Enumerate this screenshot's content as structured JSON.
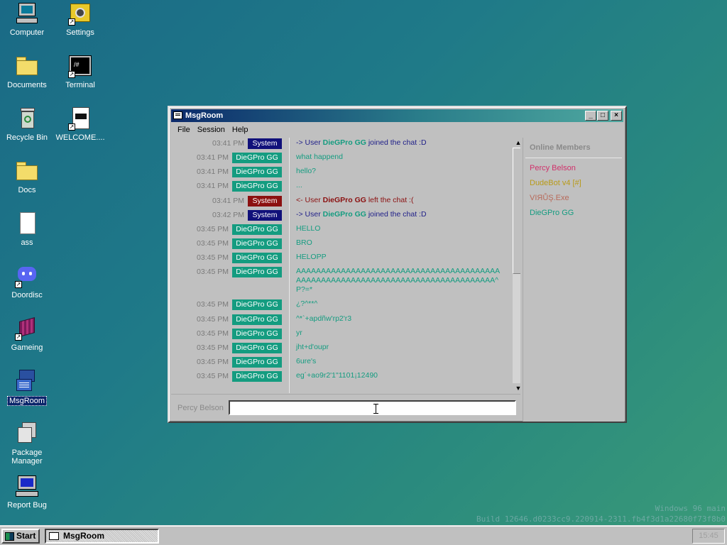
{
  "desktop": {
    "icons": [
      {
        "label": "Computer",
        "icon": "computer-icon"
      },
      {
        "label": "Settings",
        "icon": "settings-icon"
      },
      {
        "label": "Documents",
        "icon": "folder-icon"
      },
      {
        "label": "Terminal",
        "icon": "terminal-icon"
      },
      {
        "label": "Recycle Bin",
        "icon": "recycle-bin-icon"
      },
      {
        "label": "WELCOME....",
        "icon": "document-icon"
      },
      {
        "label": "Docs",
        "icon": "folder-icon"
      },
      {
        "label": "ass",
        "icon": "file-icon"
      },
      {
        "label": "Doordisc",
        "icon": "discord-icon"
      },
      {
        "label": "Gameing",
        "icon": "cube-icon"
      },
      {
        "label": "MsgRoom",
        "icon": "msgroom-icon"
      },
      {
        "label": "Package Manager",
        "icon": "package-icon"
      },
      {
        "label": "Report Bug",
        "icon": "report-bug-icon"
      }
    ]
  },
  "window": {
    "title": "MsgRoom",
    "menu": [
      "File",
      "Session",
      "Help"
    ],
    "messages": [
      {
        "time": "03:41 PM",
        "user": "System",
        "pre": "-> User ",
        "nick": "DieGPro GG",
        "post": " joined the chat :D",
        "kind": "sys-in"
      },
      {
        "time": "03:41 PM",
        "user": "DieGPro GG",
        "text": "what happend",
        "kind": "user"
      },
      {
        "time": "03:41 PM",
        "user": "DieGPro GG",
        "text": "hello?",
        "kind": "user"
      },
      {
        "time": "03:41 PM",
        "user": "DieGPro GG",
        "text": "...",
        "kind": "user"
      },
      {
        "time": "03:41 PM",
        "user": "System",
        "pre": "<- User ",
        "nick": "DieGPro GG",
        "post": " left the chat :(",
        "kind": "sys-out"
      },
      {
        "time": "03:42 PM",
        "user": "System",
        "pre": "-> User ",
        "nick": "DieGPro GG",
        "post": " joined the chat :D",
        "kind": "sys-in"
      },
      {
        "time": "03:45 PM",
        "user": "DieGPro GG",
        "text": "HELLO",
        "kind": "user"
      },
      {
        "time": "03:45 PM",
        "user": "DieGPro GG",
        "text": "BRO",
        "kind": "user"
      },
      {
        "time": "03:45 PM",
        "user": "DieGPro GG",
        "text": "HELOPP",
        "kind": "user"
      },
      {
        "time": "03:45 PM",
        "user": "DieGPro GG",
        "text": "AAAAAAAAAAAAAAAAAAAAAAAAAAAAAAAAAAAAAAAAAAAAAAAAAAAAAAAAAAAAAAAAAAAAAAAAAAAAAAAAA^P?=*",
        "kind": "user"
      },
      {
        "time": "03:45 PM",
        "user": "DieGPro GG",
        "text": "¿?^**^",
        "kind": "user"
      },
      {
        "time": "03:45 PM",
        "user": "DieGPro GG",
        "text": "^*`+apdñw'rp2'r3",
        "kind": "user"
      },
      {
        "time": "03:45 PM",
        "user": "DieGPro GG",
        "text": "yr",
        "kind": "user"
      },
      {
        "time": "03:45 PM",
        "user": "DieGPro GG",
        "text": "jht+d'oupr",
        "kind": "user"
      },
      {
        "time": "03:45 PM",
        "user": "DieGPro GG",
        "text": "6ure's",
        "kind": "user"
      },
      {
        "time": "03:45 PM",
        "user": "DieGPro GG",
        "text": "eg´+ao9r2'1\"1101¡12490",
        "kind": "user"
      }
    ],
    "members_title": "Online Members",
    "members": [
      {
        "name": "Percy Belson",
        "color": "#d0306a"
      },
      {
        "name": "DudeBot v4 [#]",
        "color": "#b89a18"
      },
      {
        "name": "VIЯŮŞ.Exe",
        "color": "#b86a5a"
      },
      {
        "name": "DieGPro GG",
        "color": "#149c80"
      }
    ],
    "input_user": "Percy Belson",
    "input_value": ""
  },
  "colors": {
    "system_badge_in": "#10107a",
    "system_badge_out": "#8b1010",
    "user_badge": "#149c80"
  },
  "build": {
    "line1": "Windows 96 main",
    "line2": "Build 12646.d0233cc9.220914-2311.fb4f3d1a22680f73f8b0"
  },
  "taskbar": {
    "start_label": "Start",
    "task_label": "MsgRoom",
    "clock": "15:45"
  }
}
